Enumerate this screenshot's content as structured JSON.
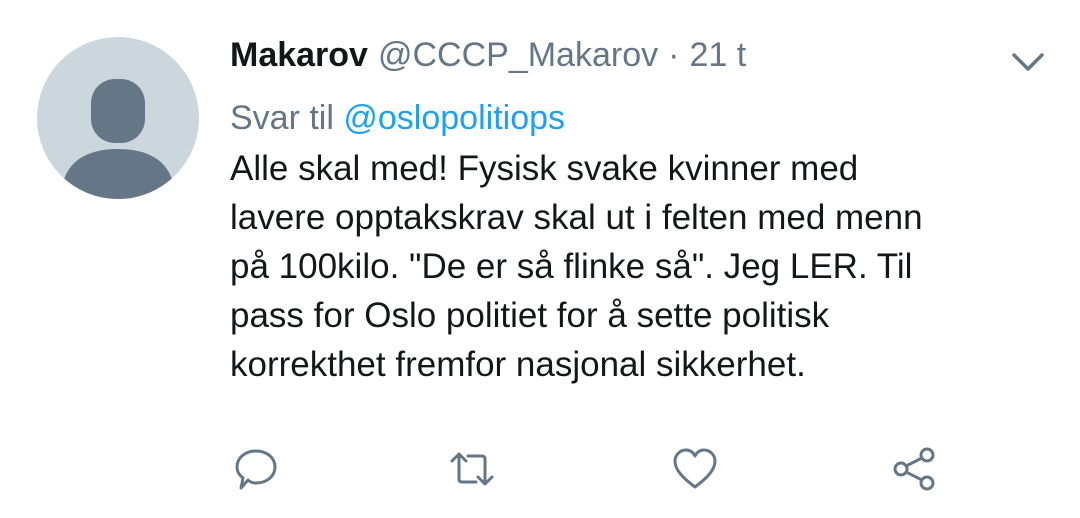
{
  "tweet": {
    "author": {
      "display_name": "Makarov",
      "handle": "@CCCP_Makarov",
      "separator": "·",
      "time": "21 t",
      "avatar_icon": "default-profile-icon"
    },
    "reply": {
      "prefix": "Svar til",
      "mention": "@oslopolitiops"
    },
    "text_lines": [
      "Alle skal med! Fysisk svake kvinner med",
      "lavere opptakskrav skal ut i felten med menn",
      "på 100kilo. \"De er så flinke så\". Jeg LER. Til",
      "pass for Oslo politiet for å sette politisk",
      "korrekthet fremfor nasjonal sikkerhet."
    ],
    "actions": [
      {
        "icon": "reply-icon"
      },
      {
        "icon": "retweet-icon"
      },
      {
        "icon": "like-icon"
      },
      {
        "icon": "share-icon"
      }
    ],
    "menu_icon": "chevron-down-icon"
  },
  "colors": {
    "text": "#14171a",
    "secondary": "#657786",
    "link": "#1da1f2",
    "avatar_bg": "#ccd6dd",
    "avatar_fg": "#657786"
  }
}
